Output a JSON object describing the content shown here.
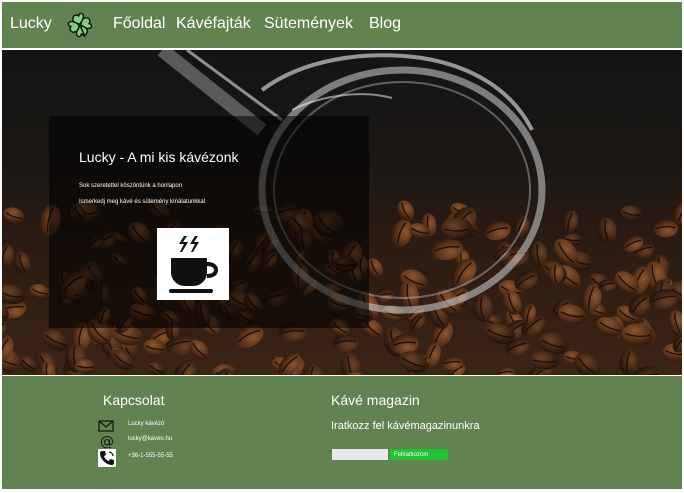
{
  "navbar": {
    "brand": "Lucky",
    "logo_icon": "four-leaf-clover-icon",
    "links": [
      {
        "label": "Főoldal"
      },
      {
        "label": "Kávéfajták"
      },
      {
        "label": "Sütemények"
      },
      {
        "label": "Blog"
      }
    ]
  },
  "hero": {
    "title": "Lucky - A mi kis kávézonk",
    "lines": [
      "Sok szeretettel köszöntünk a honlapon",
      "Ismerkedj meg kávé és sütemény kínálatunkkal"
    ],
    "icon": "coffee-cup-icon"
  },
  "footer": {
    "contact": {
      "heading": "Kapcsolat",
      "items": [
        {
          "icon": "envelope-icon",
          "text": "Lucky kávézó"
        },
        {
          "icon": "at-sign-icon",
          "text": "lucky@kaveo.hu"
        },
        {
          "icon": "phone-icon",
          "text": "+36-1-555-55-55"
        }
      ]
    },
    "magazine": {
      "heading": "Kávé magazin",
      "text": "Iratkozz fel kávémagazinunkra",
      "email_value": "",
      "button_label": "Feliratkozom"
    }
  },
  "colors": {
    "navbar_bg": "#618352",
    "footer_bg": "#618352",
    "subscribe_button": "#23c433"
  }
}
